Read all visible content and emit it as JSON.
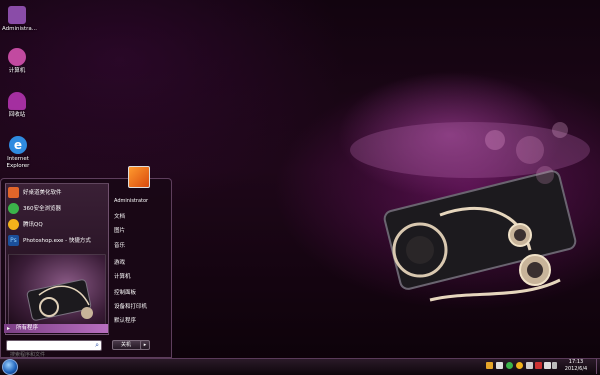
{
  "desktop": {
    "icons": [
      {
        "label": "Administra...",
        "icon": "user-folder-icon",
        "color": "#8a4ca8"
      },
      {
        "label": "计算机",
        "icon": "computer-icon",
        "color": "#c24aa0"
      },
      {
        "label": "回收站",
        "icon": "recycle-bin-icon",
        "color": "#a42fa0"
      },
      {
        "label": "Internet Explorer",
        "icon": "ie-icon",
        "color": "#2f8be0"
      }
    ]
  },
  "start_menu": {
    "pinned": [
      {
        "label": "好桌道美化软件",
        "icon": "butterfly-icon",
        "color": "#e0652a"
      },
      {
        "label": "360安全浏览器",
        "icon": "browser-360-icon",
        "color": "#3bb34a"
      },
      {
        "label": "腾讯QQ",
        "icon": "qq-penguin-icon",
        "color": "#f2b21b"
      },
      {
        "label": "Photoshop.exe - 快捷方式",
        "icon": "photoshop-icon",
        "color": "#1b4f9a"
      }
    ],
    "all_programs": "所有程序",
    "search_placeholder": "搜索程序和文件",
    "user": "Administrator",
    "right_items": [
      "文档",
      "图片",
      "音乐",
      "游戏",
      "计算机",
      "控制面板",
      "设备和打印机",
      "默认程序"
    ],
    "shutdown": "关机"
  },
  "taskbar": {
    "time": "17:13",
    "date": "2012/6/4",
    "tray_colors": [
      "#e6a52a",
      "#ddd",
      "#3bb34a",
      "#f2b21b",
      "#ccc",
      "#cc3333",
      "#ddd",
      "#bbb"
    ]
  }
}
